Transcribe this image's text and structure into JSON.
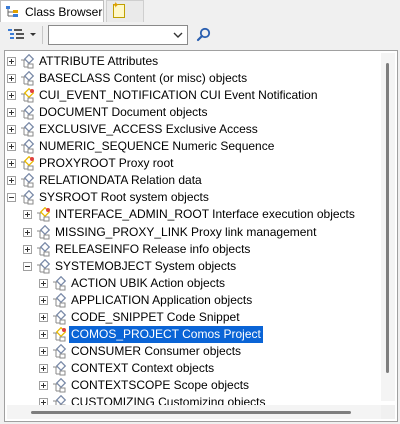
{
  "tabs": [
    {
      "label": "Class Browser",
      "icon": "class-browser-icon",
      "active": true
    },
    {
      "label": "",
      "icon": "new-document-icon",
      "active": false
    }
  ],
  "toolbar": {
    "view_button_icon": "tree-view-dropdown-icon",
    "search_value": "",
    "search_icon": "search-icon"
  },
  "colors": {
    "selection": "#0a64d6",
    "folder_yellow": "#e8b800",
    "tree_icon_gray": "#7a8aa8"
  },
  "tree": [
    {
      "text": "ATTRIBUTE Attributes",
      "icon": "class-icon"
    },
    {
      "text": "BASECLASS Content (or misc) objects",
      "icon": "class-icon"
    },
    {
      "text": "CUI_EVENT_NOTIFICATION CUI Event Notification",
      "icon": "class-special-icon"
    },
    {
      "text": "DOCUMENT Document objects",
      "icon": "class-icon"
    },
    {
      "text": "EXCLUSIVE_ACCESS Exclusive Access",
      "icon": "class-icon"
    },
    {
      "text": "NUMERIC_SEQUENCE Numeric Sequence",
      "icon": "class-icon"
    },
    {
      "text": "PROXYROOT Proxy root",
      "icon": "class-special-icon"
    },
    {
      "text": "RELATIONDATA Relation data",
      "icon": "class-icon"
    },
    {
      "text": "SYSROOT Root system objects",
      "icon": "class-icon",
      "expanded": true
    },
    {
      "text": "INTERFACE_ADMIN_ROOT Interface execution objects",
      "icon": "class-special-icon"
    },
    {
      "text": "MISSING_PROXY_LINK Proxy link management",
      "icon": "class-icon"
    },
    {
      "text": "RELEASEINFO Release info objects",
      "icon": "class-icon"
    },
    {
      "text": "SYSTEMOBJECT System objects",
      "icon": "class-icon",
      "expanded": true
    },
    {
      "text": "ACTION UBIK Action objects",
      "icon": "class-icon"
    },
    {
      "text": "APPLICATION Application objects",
      "icon": "class-icon"
    },
    {
      "text": "CODE_SNIPPET Code Snippet",
      "icon": "class-icon"
    },
    {
      "text": "COMOS_PROJECT Comos Project",
      "icon": "class-special-icon",
      "selected": true
    },
    {
      "text": "CONSUMER Consumer objects",
      "icon": "class-icon"
    },
    {
      "text": "CONTEXT Context objects",
      "icon": "class-icon"
    },
    {
      "text": "CONTEXTSCOPE Scope objects",
      "icon": "class-icon"
    },
    {
      "text": "CUSTOMIZING Customizing objects",
      "icon": "class-icon"
    }
  ]
}
